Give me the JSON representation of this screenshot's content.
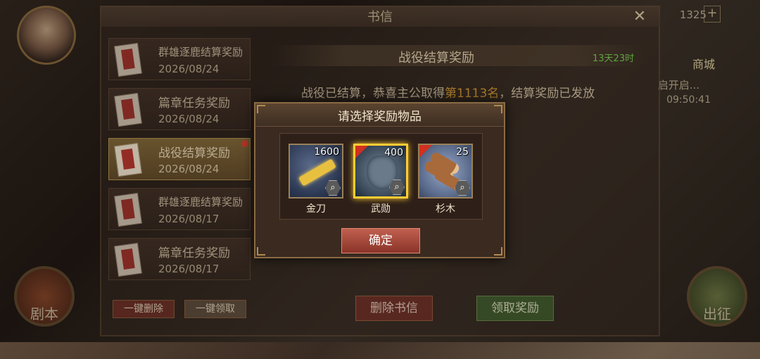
{
  "hud": {
    "currency_value": "1325",
    "plus_label": "+",
    "shop_label": "商城",
    "event_text": "启开启...",
    "event_timer": "09:50:41",
    "left_round_button": "剧本",
    "right_round_button": "出征"
  },
  "panel": {
    "title": "书信",
    "close_label": "✕",
    "mail_list": [
      {
        "name": "群雄逐鹿结算奖励",
        "date": "2026/08/24"
      },
      {
        "name": "篇章任务奖励",
        "date": "2026/08/24"
      },
      {
        "name": "战役结算奖励",
        "date": "2026/08/24"
      },
      {
        "name": "群雄逐鹿结算奖励",
        "date": "2026/08/17"
      },
      {
        "name": "篇章任务奖励",
        "date": "2026/08/17"
      }
    ],
    "delete_all_label": "一键删除",
    "collect_all_label": "一键领取"
  },
  "content": {
    "title": "战役结算奖励",
    "time_left": "13天23时",
    "text_before": "战役已结算，恭喜主公取得",
    "rank": "第1113名",
    "text_after": "，结算奖励已发放",
    "delete_label": "删除书信",
    "claim_label": "领取奖励"
  },
  "modal": {
    "title": "请选择奖励物品",
    "items": [
      {
        "name": "金刀",
        "count": "1600",
        "icon": "golden-blade-icon"
      },
      {
        "name": "武勋",
        "count": "400",
        "icon": "medal-icon"
      },
      {
        "name": "杉木",
        "count": "25",
        "icon": "logs-icon"
      }
    ],
    "confirm_label": "确定"
  },
  "colors": {
    "selected_border": "#ffcc33",
    "confirm_button": "#c06050",
    "rank_highlight": "#e0a030",
    "time_green": "#6ac04a"
  }
}
